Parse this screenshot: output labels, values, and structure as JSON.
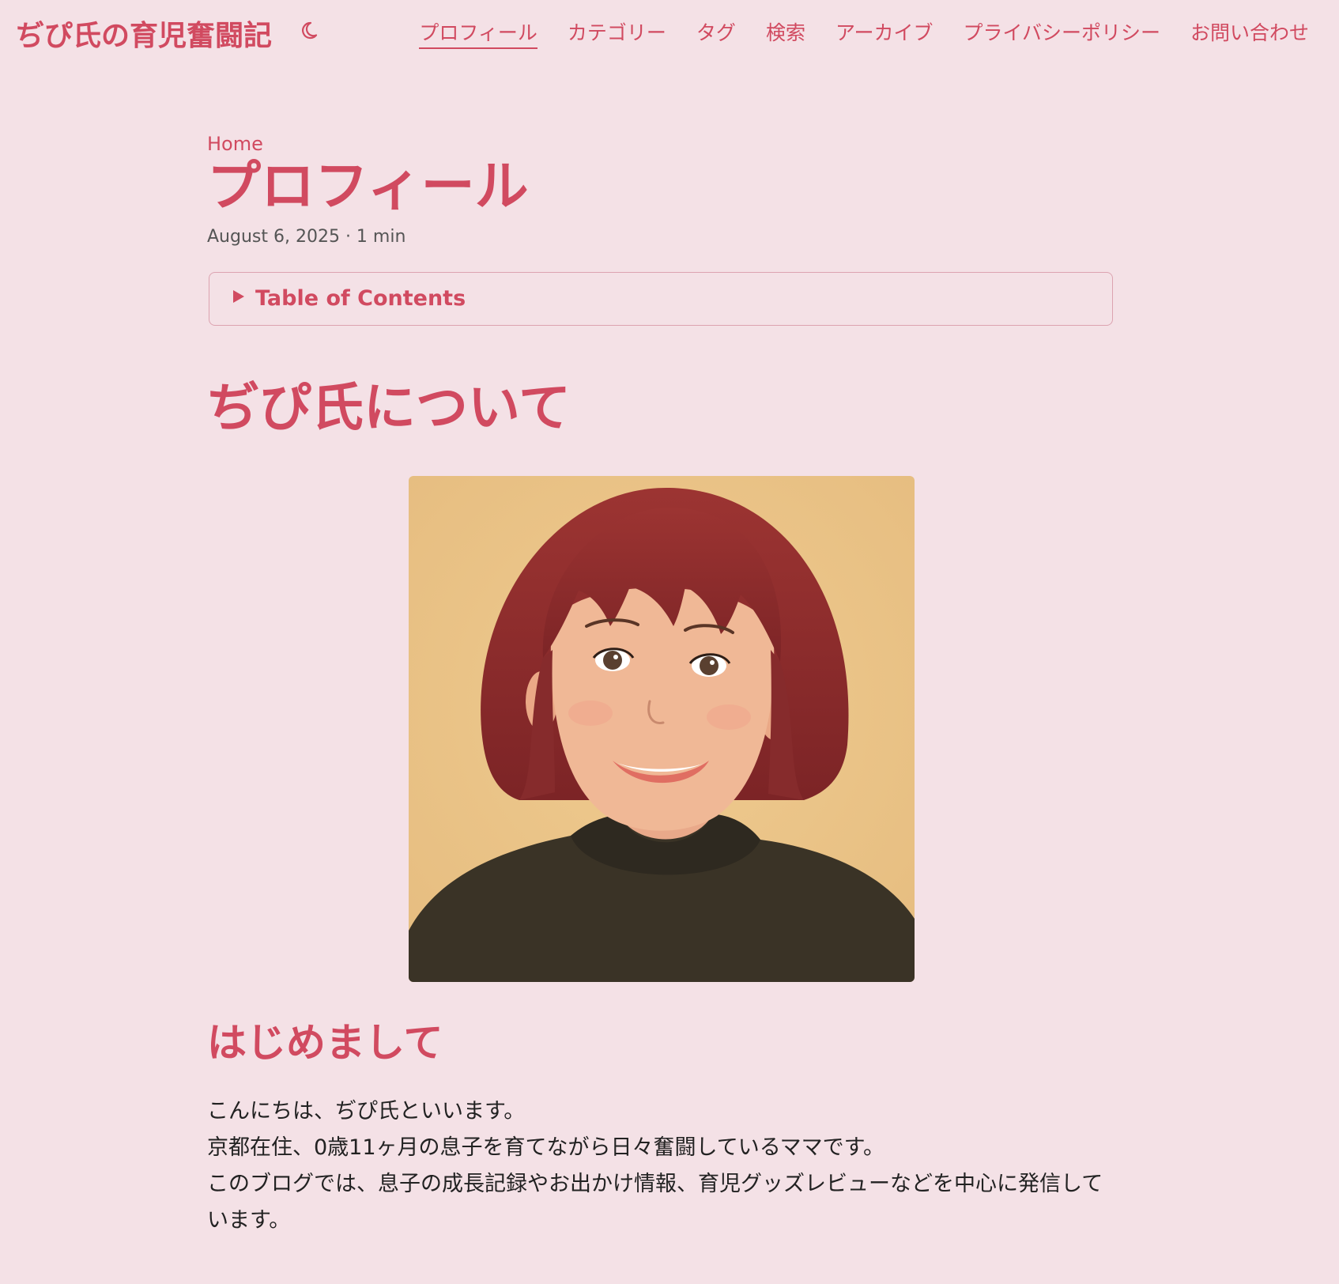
{
  "header": {
    "site_title": "ぢぴ氏の育児奮闘記",
    "theme_toggle_icon": "moon-icon",
    "nav": [
      {
        "label": "プロフィール"
      },
      {
        "label": "カテゴリー"
      },
      {
        "label": "タグ"
      },
      {
        "label": "検索"
      },
      {
        "label": "アーカイブ"
      },
      {
        "label": "プライバシーポリシー"
      },
      {
        "label": "お問い合わせ"
      }
    ]
  },
  "main": {
    "breadcrumb": "Home",
    "title": "プロフィール",
    "meta": "August 6, 2025 · 1 min",
    "toc_label": "Table of Contents",
    "toc_icon": "triangle-right-icon",
    "section_heading": "ぢぴ氏について",
    "sub_heading": "はじめまして",
    "paragraphs": [
      "こんにちは、ぢぴ氏といいます。",
      "京都在住、0歳11ヶ月の息子を育てながら日々奮闘しているママです。",
      "このブログでは、息子の成長記録やお出かけ情報、育児グッズレビューなどを中心に発信しています。"
    ]
  },
  "colors": {
    "background": "#f4e1e6",
    "accent": "#d14a60",
    "text": "#222222",
    "meta": "#555555",
    "border": "#dca3b0",
    "portrait_bg": "#ebc58a",
    "hair": "#8c2a2c",
    "sweater": "#3a3326"
  }
}
